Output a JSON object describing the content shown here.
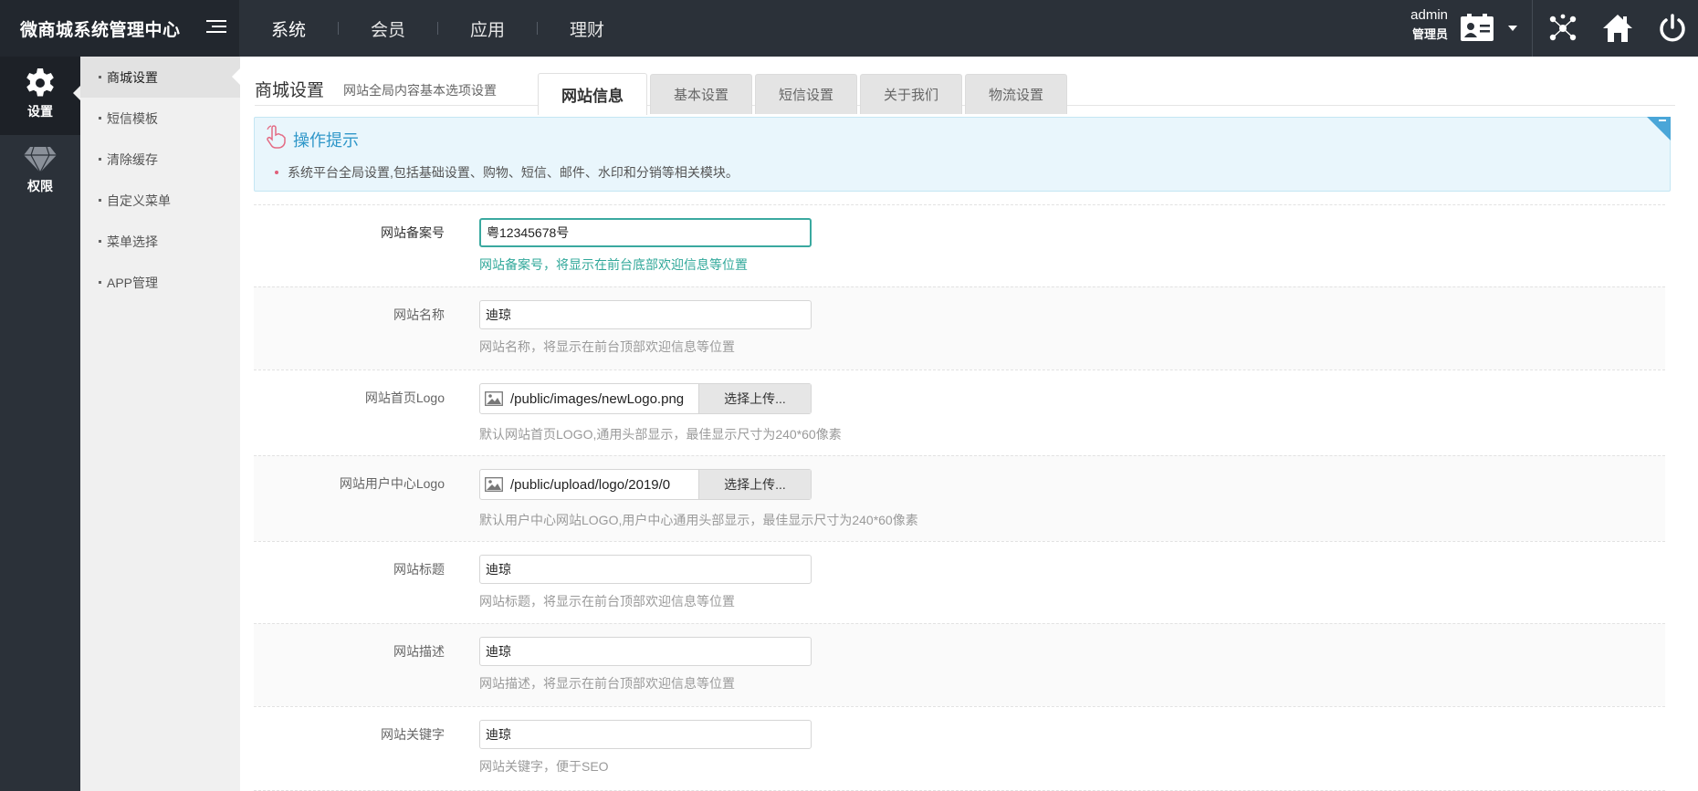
{
  "app": {
    "title": "微商城系统管理中心"
  },
  "topnav": {
    "items": [
      "系统",
      "会员",
      "应用",
      "理财"
    ]
  },
  "user": {
    "name": "admin",
    "role": "管理员"
  },
  "rail": {
    "items": [
      {
        "label": "设置",
        "icon": "gear-icon"
      },
      {
        "label": "权限",
        "icon": "diamond-icon"
      }
    ]
  },
  "submenu": {
    "items": [
      "商城设置",
      "短信模板",
      "清除缓存",
      "自定义菜单",
      "菜单选择",
      "APP管理"
    ]
  },
  "page": {
    "title": "商城设置",
    "subtitle": "网站全局内容基本选项设置"
  },
  "tabs": [
    "网站信息",
    "基本设置",
    "短信设置",
    "关于我们",
    "物流设置"
  ],
  "tip": {
    "title": "操作提示",
    "text": "系统平台全局设置,包括基础设置、购物、短信、邮件、水印和分销等相关模块。"
  },
  "form": {
    "icp": {
      "label": "网站备案号",
      "value": "粤12345678号",
      "hint": "网站备案号，将显示在前台底部欢迎信息等位置"
    },
    "name": {
      "label": "网站名称",
      "value": "迪琼",
      "hint": "网站名称，将显示在前台顶部欢迎信息等位置"
    },
    "logo": {
      "label": "网站首页Logo",
      "path": "/public/images/newLogo.png",
      "button": "选择上传...",
      "hint": "默认网站首页LOGO,通用头部显示，最佳显示尺寸为240*60像素"
    },
    "ucenter_logo": {
      "label": "网站用户中心Logo",
      "path": "/public/upload/logo/2019/0",
      "button": "选择上传...",
      "hint": "默认用户中心网站LOGO,用户中心通用头部显示，最佳显示尺寸为240*60像素"
    },
    "site_title": {
      "label": "网站标题",
      "value": "迪琼",
      "hint": "网站标题，将显示在前台顶部欢迎信息等位置"
    },
    "description": {
      "label": "网站描述",
      "value": "迪琼",
      "hint": "网站描述，将显示在前台顶部欢迎信息等位置"
    },
    "keywords": {
      "label": "网站关键字",
      "value": "迪琼",
      "hint": "网站关键字，便于SEO"
    }
  },
  "colors": {
    "topbar": "#2b3139",
    "accent": "#2f97c9",
    "focus": "#3aa9a0"
  }
}
